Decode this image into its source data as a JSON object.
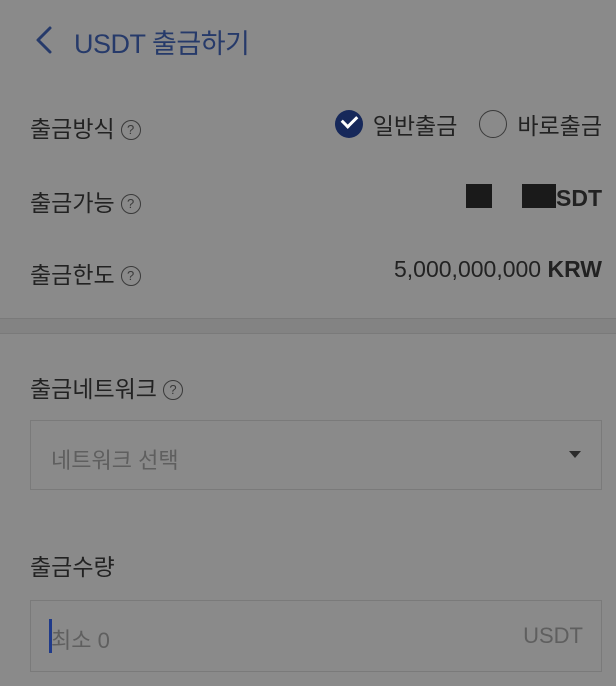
{
  "header": {
    "title": "USDT 출금하기"
  },
  "withdraw_method": {
    "label": "출금방식",
    "options": [
      {
        "label": "일반출금",
        "selected": true
      },
      {
        "label": "바로출금",
        "selected": false
      }
    ]
  },
  "available": {
    "label": "출금가능",
    "unit_visible": "SDT"
  },
  "limit": {
    "label": "출금한도",
    "amount": "5,000,000,000",
    "currency": "KRW"
  },
  "network": {
    "label": "출금네트워크",
    "placeholder": "네트워크 선택"
  },
  "amount": {
    "label": "출금수량",
    "placeholder": "최소 0",
    "unit": "USDT"
  },
  "help_icon_glyph": "?",
  "colors": {
    "title": "#263a6a",
    "radio_checked": "#16285a",
    "overlay_background": "#8a8a8a"
  }
}
